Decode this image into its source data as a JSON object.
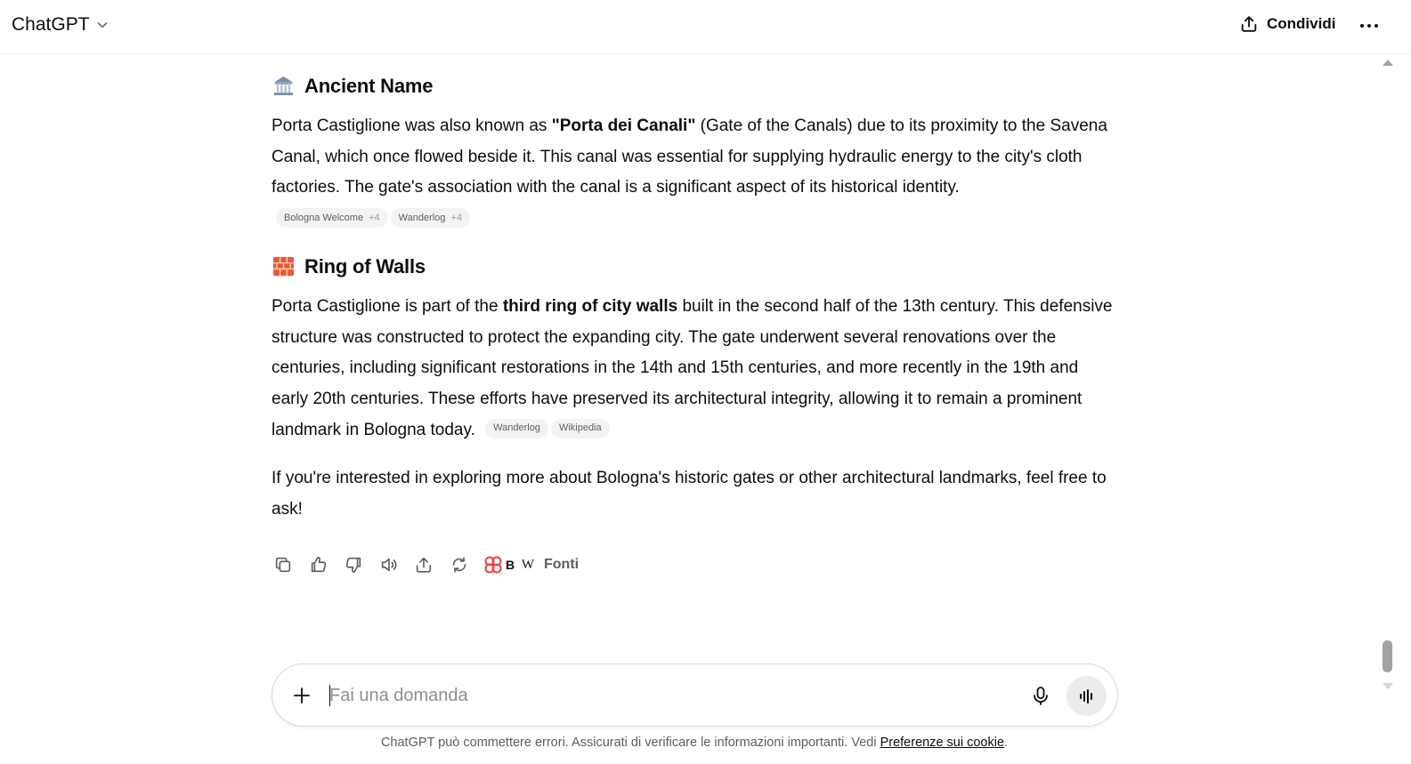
{
  "header": {
    "title": "ChatGPT",
    "share_label": "Condividi"
  },
  "sections": [
    {
      "icon": "classical-building-emoji",
      "title": "Ancient Name",
      "text": {
        "p1": "Porta Castiglione was also known as ",
        "b1": "\"Porta dei Canali\"",
        "p2": " (Gate of the Canals) due to its proximity to the Savena Canal, which once flowed beside it. This canal was essential for supplying hydraulic energy to the city's cloth factories. The gate's association with the canal is a significant aspect of its historical identity."
      },
      "citations": [
        {
          "label": "Bologna Welcome",
          "more": "+4"
        },
        {
          "label": "Wanderlog",
          "more": "+4"
        }
      ]
    },
    {
      "icon": "brick-emoji",
      "title": "Ring of Walls",
      "text": {
        "p1": "Porta Castiglione is part of the ",
        "b1": "third ring of city walls",
        "p2": " built in the second half of the 13th century. This defensive structure was constructed to protect the expanding city. The gate underwent several renovations over the centuries, including significant restorations in the 14th and 15th centuries, and more recently in the 19th and early 20th centuries. These efforts have preserved its architectural integrity, allowing it to remain a prominent landmark in Bologna today."
      },
      "citations": [
        {
          "label": "Wanderlog"
        },
        {
          "label": "Wikipedia"
        }
      ]
    }
  ],
  "closing": "If you're interested in exploring more about Bologna's historic gates or other architectural landmarks, feel free to ask!",
  "actions": {
    "icons": [
      "copy-icon",
      "thumbs-up-icon",
      "thumbs-down-icon",
      "read-aloud-icon",
      "share-icon",
      "regenerate-icon"
    ],
    "sources_label": "Fonti",
    "source_logos": [
      "B",
      "W"
    ]
  },
  "composer": {
    "placeholder": "Fai una domanda"
  },
  "footer": {
    "text": "ChatGPT può commettere errori. Assicurati di verificare le informazioni importanti. Vedi ",
    "link": "Preferenze sui cookie",
    "end": "."
  }
}
